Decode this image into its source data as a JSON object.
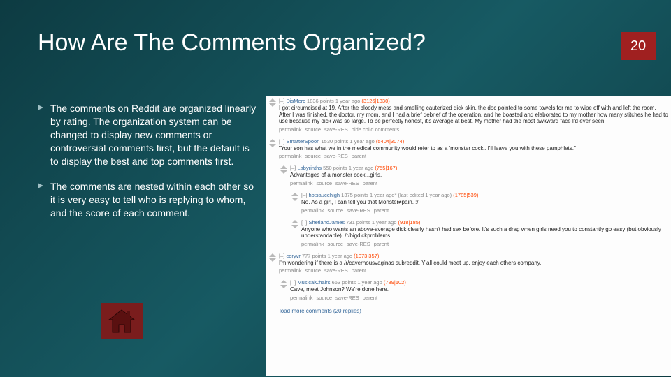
{
  "colors": {
    "accent": "#a02020",
    "bg_from": "#0d3b42",
    "bg_to": "#175a63"
  },
  "slide": {
    "number": "20",
    "title": "How Are The Comments Organized?",
    "bullets": [
      "The comments on Reddit are organized linearly by rating. The organization system can be changed to display new comments or controversial comments first, but the default is to display the best and top comments first.",
      "The comments are nested within each other so it is very easy to tell who is replying to whom, and the score of each comment."
    ]
  },
  "reddit": {
    "comments": [
      {
        "indent": 0,
        "author": "DisMerc",
        "points": "1836 points",
        "age": "1 year ago",
        "score": "(3126|1330)",
        "body": "I got circumcised at 19. After the bloody mess and smelling cauterized dick skin, the doc pointed to some towels for me to wipe off with and left the room. After I was finished, the doctor, my mom, and I had a brief debrief of the operation, and he boasted and elaborated to my mother how many stitches he had to use because my dick was so large.\nTo be perfectly honest, it's average at best. My mother had the most awkward face I'd ever seen.",
        "actions": "permalink  source  save-RES  hide child comments"
      },
      {
        "indent": 0,
        "author": "SmatterSpoon",
        "points": "1530 points",
        "age": "1 year ago",
        "score": "(5404|3074)",
        "body": "\"Your son has what we in the medical community would refer to as a 'monster cock'. I'll leave you with these pamphlets.\"",
        "actions": "permalink  source  save-RES  parent"
      },
      {
        "indent": 1,
        "author": "Labyrinths",
        "points": "550 points",
        "age": "1 year ago",
        "score": "(755|167)",
        "body": "Advantages of a monster cock...girls.",
        "actions": "permalink  source  save-RES  parent"
      },
      {
        "indent": 2,
        "author": "hotsaucehigh",
        "points": "1375 points",
        "age": "1 year ago* (last edited 1 year ago)",
        "score": "(1785|539)",
        "body": "No. As a girl, I can tell you that Monster≠pain. :/",
        "actions": "permalink  source  save-RES  parent"
      },
      {
        "indent": 2,
        "author": "ShetlandJames",
        "points": "731 points",
        "age": "1 year ago",
        "score": "(918|185)",
        "body": "Anyone who wants an above-average dick clearly hasn't had sex before. It's such a drag when girls need you to constantly go easy (but obviously understandable).\n/r/bigdickproblems",
        "actions": "permalink  source  save-RES  parent"
      },
      {
        "indent": 0,
        "author": "coryvr",
        "points": "777 points",
        "age": "1 year ago",
        "score": "(1073|357)",
        "body": "I'm wondering if there is a /r/cavernousvaginas subreddit. Y'all could meet up, enjoy each others company.",
        "actions": "permalink  source  save-RES  parent"
      },
      {
        "indent": 1,
        "author": "MusicalChairs",
        "points": "663 points",
        "age": "1 year ago",
        "score": "(789|102)",
        "body": "Cave, meet Johnson? We're done here.",
        "actions": "permalink  source  save-RES  parent"
      }
    ],
    "load_more": "load more comments  (20 replies)"
  }
}
